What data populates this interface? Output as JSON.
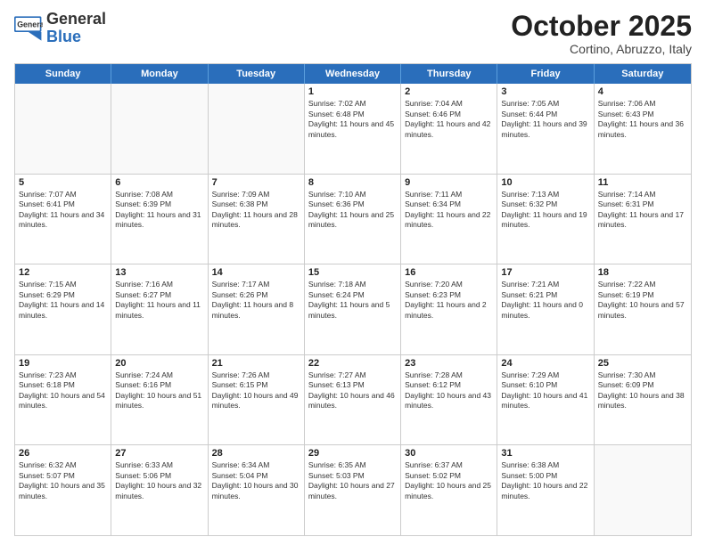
{
  "header": {
    "logo_general": "General",
    "logo_blue": "Blue",
    "month_title": "October 2025",
    "location": "Cortino, Abruzzo, Italy"
  },
  "days_of_week": [
    "Sunday",
    "Monday",
    "Tuesday",
    "Wednesday",
    "Thursday",
    "Friday",
    "Saturday"
  ],
  "weeks": [
    [
      {
        "day": "",
        "text": ""
      },
      {
        "day": "",
        "text": ""
      },
      {
        "day": "",
        "text": ""
      },
      {
        "day": "1",
        "text": "Sunrise: 7:02 AM\nSunset: 6:48 PM\nDaylight: 11 hours and 45 minutes."
      },
      {
        "day": "2",
        "text": "Sunrise: 7:04 AM\nSunset: 6:46 PM\nDaylight: 11 hours and 42 minutes."
      },
      {
        "day": "3",
        "text": "Sunrise: 7:05 AM\nSunset: 6:44 PM\nDaylight: 11 hours and 39 minutes."
      },
      {
        "day": "4",
        "text": "Sunrise: 7:06 AM\nSunset: 6:43 PM\nDaylight: 11 hours and 36 minutes."
      }
    ],
    [
      {
        "day": "5",
        "text": "Sunrise: 7:07 AM\nSunset: 6:41 PM\nDaylight: 11 hours and 34 minutes."
      },
      {
        "day": "6",
        "text": "Sunrise: 7:08 AM\nSunset: 6:39 PM\nDaylight: 11 hours and 31 minutes."
      },
      {
        "day": "7",
        "text": "Sunrise: 7:09 AM\nSunset: 6:38 PM\nDaylight: 11 hours and 28 minutes."
      },
      {
        "day": "8",
        "text": "Sunrise: 7:10 AM\nSunset: 6:36 PM\nDaylight: 11 hours and 25 minutes."
      },
      {
        "day": "9",
        "text": "Sunrise: 7:11 AM\nSunset: 6:34 PM\nDaylight: 11 hours and 22 minutes."
      },
      {
        "day": "10",
        "text": "Sunrise: 7:13 AM\nSunset: 6:32 PM\nDaylight: 11 hours and 19 minutes."
      },
      {
        "day": "11",
        "text": "Sunrise: 7:14 AM\nSunset: 6:31 PM\nDaylight: 11 hours and 17 minutes."
      }
    ],
    [
      {
        "day": "12",
        "text": "Sunrise: 7:15 AM\nSunset: 6:29 PM\nDaylight: 11 hours and 14 minutes."
      },
      {
        "day": "13",
        "text": "Sunrise: 7:16 AM\nSunset: 6:27 PM\nDaylight: 11 hours and 11 minutes."
      },
      {
        "day": "14",
        "text": "Sunrise: 7:17 AM\nSunset: 6:26 PM\nDaylight: 11 hours and 8 minutes."
      },
      {
        "day": "15",
        "text": "Sunrise: 7:18 AM\nSunset: 6:24 PM\nDaylight: 11 hours and 5 minutes."
      },
      {
        "day": "16",
        "text": "Sunrise: 7:20 AM\nSunset: 6:23 PM\nDaylight: 11 hours and 2 minutes."
      },
      {
        "day": "17",
        "text": "Sunrise: 7:21 AM\nSunset: 6:21 PM\nDaylight: 11 hours and 0 minutes."
      },
      {
        "day": "18",
        "text": "Sunrise: 7:22 AM\nSunset: 6:19 PM\nDaylight: 10 hours and 57 minutes."
      }
    ],
    [
      {
        "day": "19",
        "text": "Sunrise: 7:23 AM\nSunset: 6:18 PM\nDaylight: 10 hours and 54 minutes."
      },
      {
        "day": "20",
        "text": "Sunrise: 7:24 AM\nSunset: 6:16 PM\nDaylight: 10 hours and 51 minutes."
      },
      {
        "day": "21",
        "text": "Sunrise: 7:26 AM\nSunset: 6:15 PM\nDaylight: 10 hours and 49 minutes."
      },
      {
        "day": "22",
        "text": "Sunrise: 7:27 AM\nSunset: 6:13 PM\nDaylight: 10 hours and 46 minutes."
      },
      {
        "day": "23",
        "text": "Sunrise: 7:28 AM\nSunset: 6:12 PM\nDaylight: 10 hours and 43 minutes."
      },
      {
        "day": "24",
        "text": "Sunrise: 7:29 AM\nSunset: 6:10 PM\nDaylight: 10 hours and 41 minutes."
      },
      {
        "day": "25",
        "text": "Sunrise: 7:30 AM\nSunset: 6:09 PM\nDaylight: 10 hours and 38 minutes."
      }
    ],
    [
      {
        "day": "26",
        "text": "Sunrise: 6:32 AM\nSunset: 5:07 PM\nDaylight: 10 hours and 35 minutes."
      },
      {
        "day": "27",
        "text": "Sunrise: 6:33 AM\nSunset: 5:06 PM\nDaylight: 10 hours and 32 minutes."
      },
      {
        "day": "28",
        "text": "Sunrise: 6:34 AM\nSunset: 5:04 PM\nDaylight: 10 hours and 30 minutes."
      },
      {
        "day": "29",
        "text": "Sunrise: 6:35 AM\nSunset: 5:03 PM\nDaylight: 10 hours and 27 minutes."
      },
      {
        "day": "30",
        "text": "Sunrise: 6:37 AM\nSunset: 5:02 PM\nDaylight: 10 hours and 25 minutes."
      },
      {
        "day": "31",
        "text": "Sunrise: 6:38 AM\nSunset: 5:00 PM\nDaylight: 10 hours and 22 minutes."
      },
      {
        "day": "",
        "text": ""
      }
    ]
  ]
}
